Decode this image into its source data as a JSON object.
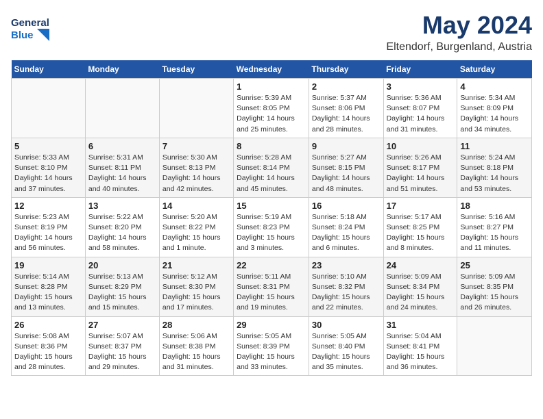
{
  "logo": {
    "line1": "General",
    "line2": "Blue"
  },
  "title": "May 2024",
  "subtitle": "Eltendorf, Burgenland, Austria",
  "headers": [
    "Sunday",
    "Monday",
    "Tuesday",
    "Wednesday",
    "Thursday",
    "Friday",
    "Saturday"
  ],
  "weeks": [
    [
      {
        "day": "",
        "info": ""
      },
      {
        "day": "",
        "info": ""
      },
      {
        "day": "",
        "info": ""
      },
      {
        "day": "1",
        "info": "Sunrise: 5:39 AM\nSunset: 8:05 PM\nDaylight: 14 hours\nand 25 minutes."
      },
      {
        "day": "2",
        "info": "Sunrise: 5:37 AM\nSunset: 8:06 PM\nDaylight: 14 hours\nand 28 minutes."
      },
      {
        "day": "3",
        "info": "Sunrise: 5:36 AM\nSunset: 8:07 PM\nDaylight: 14 hours\nand 31 minutes."
      },
      {
        "day": "4",
        "info": "Sunrise: 5:34 AM\nSunset: 8:09 PM\nDaylight: 14 hours\nand 34 minutes."
      }
    ],
    [
      {
        "day": "5",
        "info": "Sunrise: 5:33 AM\nSunset: 8:10 PM\nDaylight: 14 hours\nand 37 minutes."
      },
      {
        "day": "6",
        "info": "Sunrise: 5:31 AM\nSunset: 8:11 PM\nDaylight: 14 hours\nand 40 minutes."
      },
      {
        "day": "7",
        "info": "Sunrise: 5:30 AM\nSunset: 8:13 PM\nDaylight: 14 hours\nand 42 minutes."
      },
      {
        "day": "8",
        "info": "Sunrise: 5:28 AM\nSunset: 8:14 PM\nDaylight: 14 hours\nand 45 minutes."
      },
      {
        "day": "9",
        "info": "Sunrise: 5:27 AM\nSunset: 8:15 PM\nDaylight: 14 hours\nand 48 minutes."
      },
      {
        "day": "10",
        "info": "Sunrise: 5:26 AM\nSunset: 8:17 PM\nDaylight: 14 hours\nand 51 minutes."
      },
      {
        "day": "11",
        "info": "Sunrise: 5:24 AM\nSunset: 8:18 PM\nDaylight: 14 hours\nand 53 minutes."
      }
    ],
    [
      {
        "day": "12",
        "info": "Sunrise: 5:23 AM\nSunset: 8:19 PM\nDaylight: 14 hours\nand 56 minutes."
      },
      {
        "day": "13",
        "info": "Sunrise: 5:22 AM\nSunset: 8:20 PM\nDaylight: 14 hours\nand 58 minutes."
      },
      {
        "day": "14",
        "info": "Sunrise: 5:20 AM\nSunset: 8:22 PM\nDaylight: 15 hours\nand 1 minute."
      },
      {
        "day": "15",
        "info": "Sunrise: 5:19 AM\nSunset: 8:23 PM\nDaylight: 15 hours\nand 3 minutes."
      },
      {
        "day": "16",
        "info": "Sunrise: 5:18 AM\nSunset: 8:24 PM\nDaylight: 15 hours\nand 6 minutes."
      },
      {
        "day": "17",
        "info": "Sunrise: 5:17 AM\nSunset: 8:25 PM\nDaylight: 15 hours\nand 8 minutes."
      },
      {
        "day": "18",
        "info": "Sunrise: 5:16 AM\nSunset: 8:27 PM\nDaylight: 15 hours\nand 11 minutes."
      }
    ],
    [
      {
        "day": "19",
        "info": "Sunrise: 5:14 AM\nSunset: 8:28 PM\nDaylight: 15 hours\nand 13 minutes."
      },
      {
        "day": "20",
        "info": "Sunrise: 5:13 AM\nSunset: 8:29 PM\nDaylight: 15 hours\nand 15 minutes."
      },
      {
        "day": "21",
        "info": "Sunrise: 5:12 AM\nSunset: 8:30 PM\nDaylight: 15 hours\nand 17 minutes."
      },
      {
        "day": "22",
        "info": "Sunrise: 5:11 AM\nSunset: 8:31 PM\nDaylight: 15 hours\nand 19 minutes."
      },
      {
        "day": "23",
        "info": "Sunrise: 5:10 AM\nSunset: 8:32 PM\nDaylight: 15 hours\nand 22 minutes."
      },
      {
        "day": "24",
        "info": "Sunrise: 5:09 AM\nSunset: 8:34 PM\nDaylight: 15 hours\nand 24 minutes."
      },
      {
        "day": "25",
        "info": "Sunrise: 5:09 AM\nSunset: 8:35 PM\nDaylight: 15 hours\nand 26 minutes."
      }
    ],
    [
      {
        "day": "26",
        "info": "Sunrise: 5:08 AM\nSunset: 8:36 PM\nDaylight: 15 hours\nand 28 minutes."
      },
      {
        "day": "27",
        "info": "Sunrise: 5:07 AM\nSunset: 8:37 PM\nDaylight: 15 hours\nand 29 minutes."
      },
      {
        "day": "28",
        "info": "Sunrise: 5:06 AM\nSunset: 8:38 PM\nDaylight: 15 hours\nand 31 minutes."
      },
      {
        "day": "29",
        "info": "Sunrise: 5:05 AM\nSunset: 8:39 PM\nDaylight: 15 hours\nand 33 minutes."
      },
      {
        "day": "30",
        "info": "Sunrise: 5:05 AM\nSunset: 8:40 PM\nDaylight: 15 hours\nand 35 minutes."
      },
      {
        "day": "31",
        "info": "Sunrise: 5:04 AM\nSunset: 8:41 PM\nDaylight: 15 hours\nand 36 minutes."
      },
      {
        "day": "",
        "info": ""
      }
    ]
  ]
}
